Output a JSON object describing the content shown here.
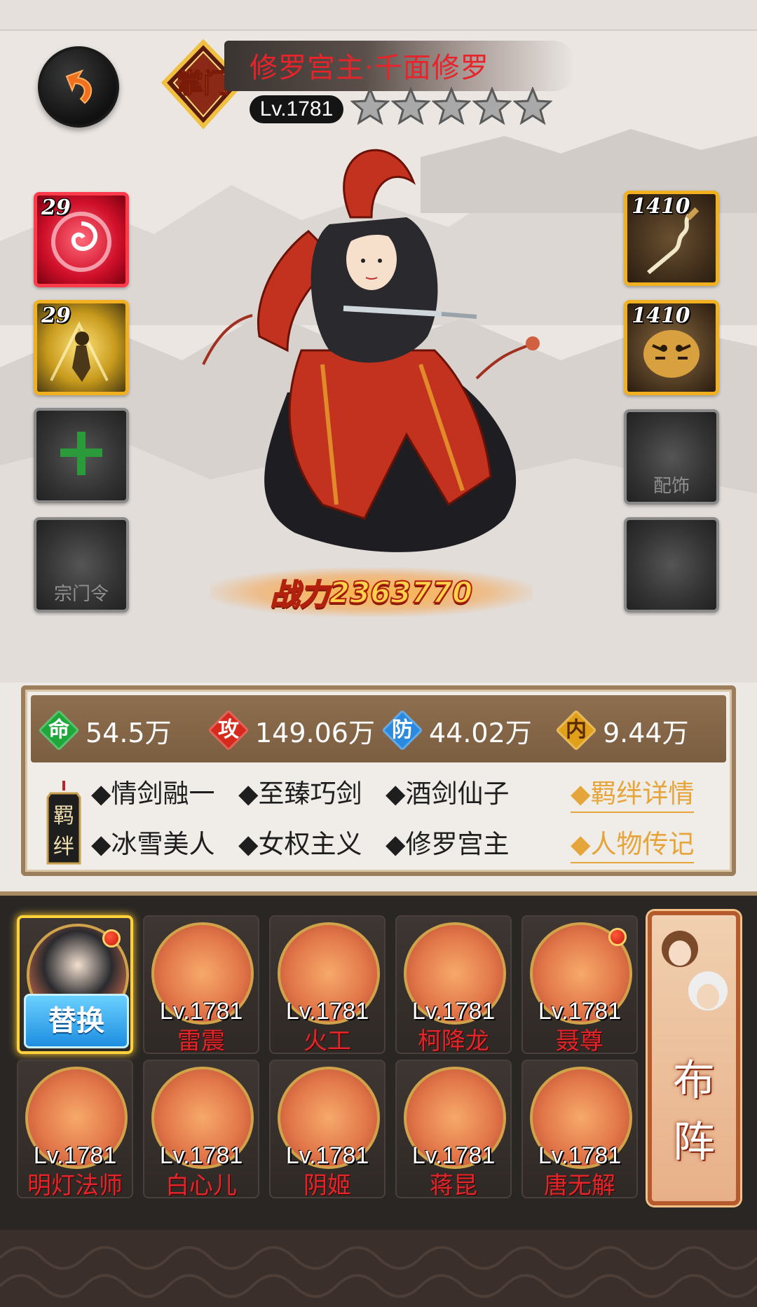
{
  "hero": {
    "sect_badge": "掌门",
    "name": "修罗宫主·千面修罗",
    "level": "Lv.1781",
    "stars": 5
  },
  "equipment": {
    "left": [
      {
        "level": "29",
        "icon": "red-swirl-skill-icon"
      },
      {
        "level": "29",
        "icon": "golden-warrior-skill-icon"
      },
      {
        "empty": true,
        "label": "",
        "icon": "plus-icon"
      },
      {
        "empty": true,
        "label": "宗门令"
      }
    ],
    "right": [
      {
        "level": "1410",
        "icon": "wavy-sword-icon"
      },
      {
        "level": "1410",
        "icon": "tiger-armor-icon"
      },
      {
        "empty": true,
        "label": "配饰"
      },
      {
        "empty": true,
        "label": ""
      }
    ]
  },
  "power": {
    "label": "战力",
    "value": "2363770"
  },
  "stats": [
    {
      "glyph": "命",
      "value": "54.5万",
      "color": "#1fa83a"
    },
    {
      "glyph": "攻",
      "value": "149.06万",
      "color": "#d62a1c"
    },
    {
      "glyph": "防",
      "value": "44.02万",
      "color": "#2a8ae0"
    },
    {
      "glyph": "内",
      "value": "9.44万",
      "color": "#e0a01a"
    }
  ],
  "bonds": {
    "tag": "羁绊",
    "items": [
      "◆情剑融一",
      "◆至臻巧剑",
      "◆酒剑仙子",
      "◆冰雪美人",
      "◆女权主义",
      "◆修罗宫主"
    ],
    "detail_link": "◆羁绊详情",
    "bio_link": "◆人物传记"
  },
  "team": {
    "replace_label": "替换",
    "members": [
      {
        "level": "",
        "name": "",
        "selected": true
      },
      {
        "level": "Lv.1781",
        "name": "雷震"
      },
      {
        "level": "Lv.1781",
        "name": "火工"
      },
      {
        "level": "Lv.1781",
        "name": "柯降龙"
      },
      {
        "level": "Lv.1781",
        "name": "聂尊",
        "dot": true
      },
      {
        "level": "Lv.1781",
        "name": "明灯法师"
      },
      {
        "level": "Lv.1781",
        "name": "白心儿"
      },
      {
        "level": "Lv.1781",
        "name": "阴姬"
      },
      {
        "level": "Lv.1781",
        "name": "蒋昆"
      },
      {
        "level": "Lv.1781",
        "name": "唐无解"
      }
    ],
    "formation_label": "布阵"
  }
}
